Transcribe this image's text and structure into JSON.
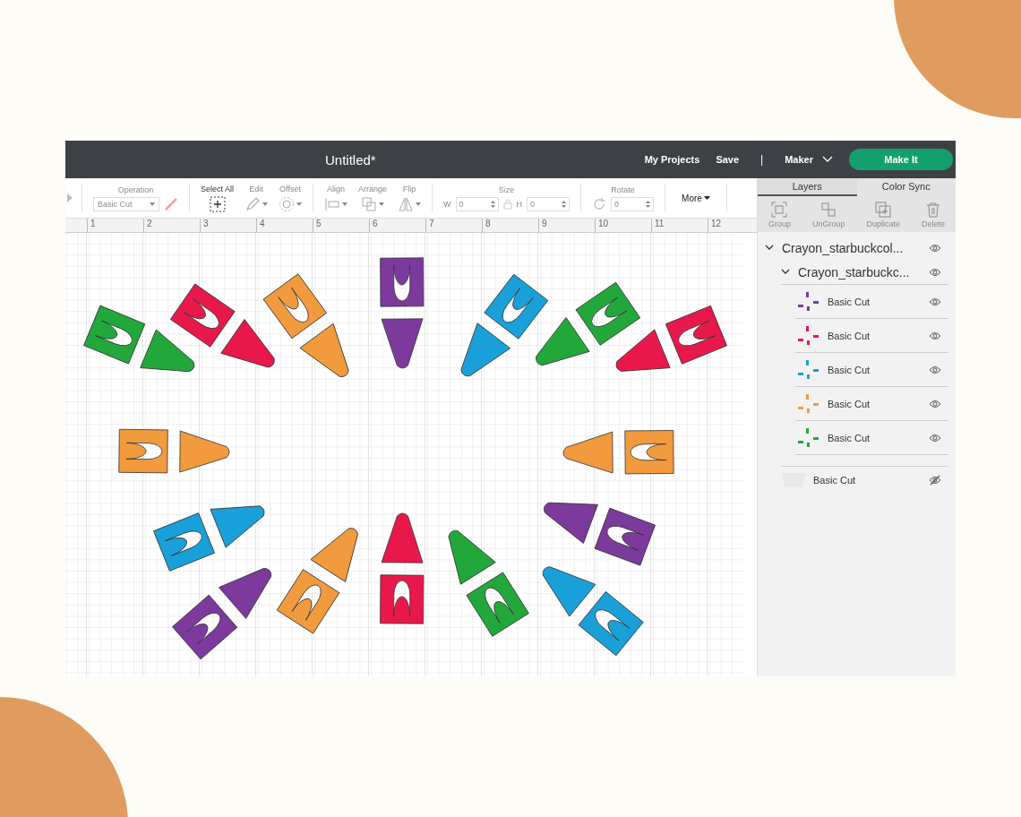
{
  "window": {
    "title": "Untitled*"
  },
  "header": {
    "links": [
      "My Projects",
      "Save"
    ],
    "separator": "|",
    "machine": "Maker",
    "make_button": "Make It"
  },
  "toolbar": {
    "groups": [
      [
        {
          "kind": "operation",
          "label": "Operation",
          "value": "Basic Cut",
          "disabled": true
        }
      ],
      [
        {
          "kind": "select-all",
          "label": "Select All",
          "disabled": false
        },
        {
          "kind": "edit",
          "label": "Edit",
          "disabled": true
        },
        {
          "kind": "offset",
          "label": "Offset",
          "disabled": true
        }
      ],
      [
        {
          "kind": "align",
          "label": "Align",
          "disabled": true
        },
        {
          "kind": "arrange",
          "label": "Arrange",
          "disabled": true
        },
        {
          "kind": "flip",
          "label": "Flip",
          "disabled": true
        }
      ],
      [
        {
          "kind": "size",
          "label": "Size",
          "w_label": "W",
          "w_value": "0",
          "h_label": "H",
          "h_value": "0",
          "disabled": true
        }
      ],
      [
        {
          "kind": "rotate",
          "label": "Rotate",
          "value": "0",
          "disabled": true
        }
      ],
      [
        {
          "kind": "more",
          "label": "More",
          "disabled": false
        }
      ]
    ]
  },
  "ruler": [
    "1",
    "2",
    "3",
    "4",
    "5",
    "6",
    "7",
    "8",
    "9",
    "10",
    "11",
    "12"
  ],
  "panel": {
    "tabs": [
      {
        "label": "Layers",
        "selected": true
      },
      {
        "label": "Color Sync",
        "selected": false
      }
    ],
    "actions": [
      {
        "kind": "group",
        "label": "Group",
        "disabled": true
      },
      {
        "kind": "ungroup",
        "label": "UnGroup",
        "disabled": true
      },
      {
        "kind": "duplicate",
        "label": "Duplicate",
        "disabled": true
      },
      {
        "kind": "delete",
        "label": "Delete",
        "disabled": true
      }
    ],
    "layers": [
      {
        "label": "Crayon_starbuckcol...",
        "visible": true,
        "expanded": true,
        "children": [
          {
            "label": "Crayon_starbuckc...",
            "visible": true,
            "expanded": true,
            "children": [
              {
                "label": "Basic Cut",
                "visible": true,
                "color": "#7b3a9c"
              },
              {
                "label": "Basic Cut",
                "visible": true,
                "color": "#e8194a"
              },
              {
                "label": "Basic Cut",
                "visible": true,
                "color": "#1aa0d8"
              },
              {
                "label": "Basic Cut",
                "visible": true,
                "color": "#f19a3e"
              },
              {
                "label": "Basic Cut",
                "visible": true,
                "color": "#22a83a"
              }
            ]
          }
        ]
      },
      {
        "label": "Basic Cut",
        "visible": false
      }
    ]
  }
}
